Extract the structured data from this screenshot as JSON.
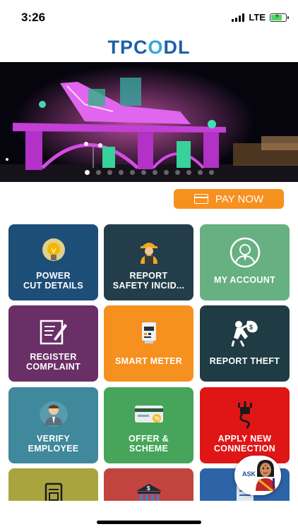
{
  "status_bar": {
    "time": "3:26",
    "network": "LTE",
    "battery_level": 0.8
  },
  "header": {
    "logo_part1": "TPC",
    "logo_o": "O",
    "logo_part2": "DL"
  },
  "banner": {
    "slide_count": 12,
    "active_slide": 0
  },
  "pay_now": {
    "label": "PAY NOW",
    "icon": "credit-card-icon"
  },
  "tiles": [
    {
      "label": "POWER\nCUT DETAILS",
      "color": "#1d4e78",
      "icon": "bulb-icon"
    },
    {
      "label": "REPORT\nSAFETY INCID...",
      "color": "#233e4a",
      "icon": "worker-icon"
    },
    {
      "label": "MY ACCOUNT",
      "color": "#67b081",
      "icon": "account-icon"
    },
    {
      "label": "REGISTER\nCOMPLAINT",
      "color": "#6a2f66",
      "icon": "complaint-icon"
    },
    {
      "label": "SMART METER",
      "color": "#f6901e",
      "icon": "meter-icon"
    },
    {
      "label": "REPORT THEFT",
      "color": "#1f3c44",
      "icon": "theft-icon"
    },
    {
      "label": "VERIFY\nEMPLOYEE",
      "color": "#40889b",
      "icon": "employee-icon"
    },
    {
      "label": "OFFER &\nSCHEME",
      "color": "#46a55a",
      "icon": "offer-card-icon"
    },
    {
      "label": "APPLY NEW\nCONNECTION",
      "color": "#e01616",
      "icon": "plug-icon"
    },
    {
      "label": "",
      "color": "#a9a43e",
      "icon": "bill-icon"
    },
    {
      "label": "",
      "color": "#c2443f",
      "icon": "bank-icon"
    },
    {
      "label": "",
      "color": "#2d63a7",
      "icon": "document-icon"
    }
  ],
  "ask_button": {
    "label": "ASK",
    "icon": "assistant-avatar-icon"
  }
}
